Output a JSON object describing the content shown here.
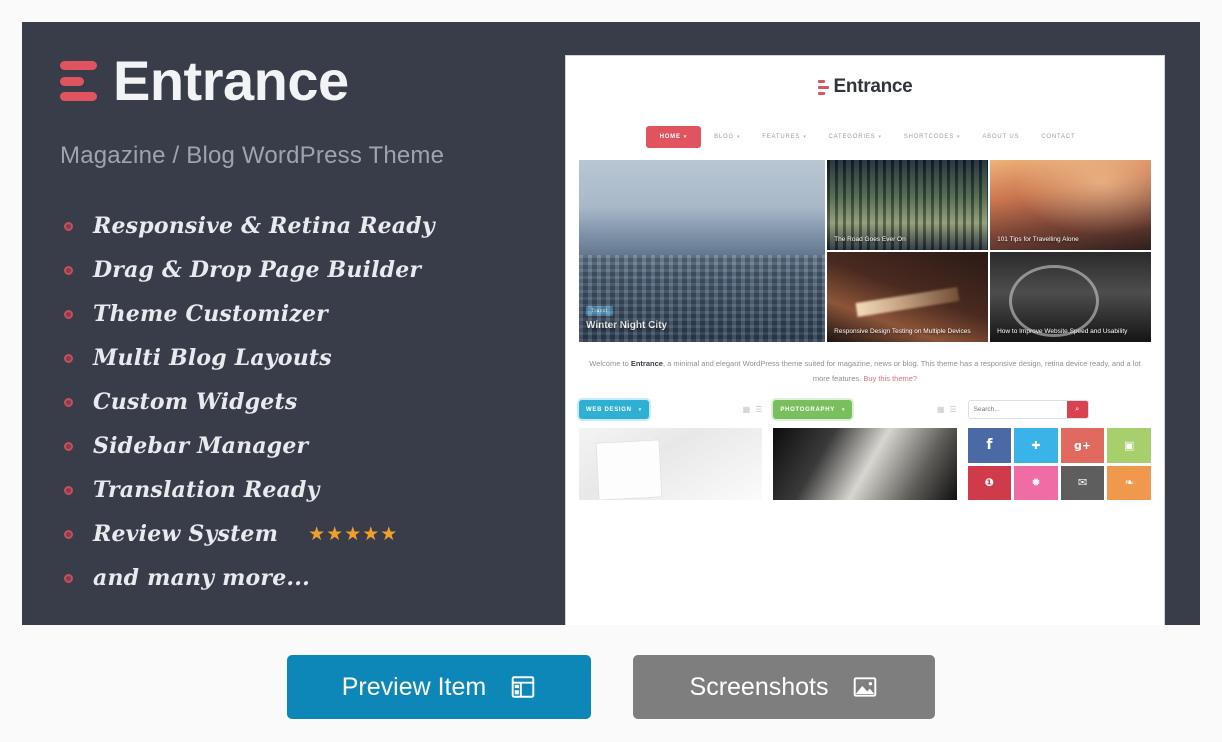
{
  "theme": {
    "accent_red": "#e0545f",
    "panel_bg": "#383d49",
    "page_bg": "#fafafa",
    "preview_button_color": "#0c87b8",
    "screenshots_button_color": "#7e7e7e"
  },
  "hero": {
    "brand_name": "Entrance",
    "tagline": "Magazine / Blog WordPress Theme",
    "features": [
      {
        "label": "Responsive & Retina Ready",
        "stars": ""
      },
      {
        "label": "Drag & Drop Page Builder",
        "stars": ""
      },
      {
        "label": "Theme Customizer",
        "stars": ""
      },
      {
        "label": "Multi Blog Layouts",
        "stars": ""
      },
      {
        "label": "Custom Widgets",
        "stars": ""
      },
      {
        "label": "Sidebar Manager",
        "stars": ""
      },
      {
        "label": "Translation Ready",
        "stars": ""
      },
      {
        "label": "Review System",
        "stars": "★★★★★"
      },
      {
        "label": "and many more...",
        "stars": ""
      }
    ]
  },
  "preview": {
    "brand_name": "Entrance",
    "nav": [
      {
        "label": "HOME",
        "caret": "▾",
        "active": true
      },
      {
        "label": "BLOG",
        "caret": "▾",
        "active": false
      },
      {
        "label": "FEATURES",
        "caret": "▾",
        "active": false
      },
      {
        "label": "CATEGORIES",
        "caret": "▾",
        "active": false
      },
      {
        "label": "SHORTCODES",
        "caret": "▾",
        "active": false
      },
      {
        "label": "ABOUT US",
        "caret": "",
        "active": false
      },
      {
        "label": "CONTACT",
        "caret": "",
        "active": false
      }
    ],
    "grid": {
      "featured": {
        "title": "Winter Night City",
        "category": "Travel"
      },
      "tiles": [
        {
          "title": "The Road Goes Ever On"
        },
        {
          "title": "101 Tips for Travelling Alone"
        },
        {
          "title": "Responsive Design Testing on Multiple Devices"
        },
        {
          "title": "How to Improve Website Speed and Usability"
        }
      ]
    },
    "welcome": {
      "lead": "Welcome to ",
      "brand": "Entrance",
      "body": ", a minimal and elegant WordPress theme suited for magazine, news or blog. This theme has a responsive design, retina device ready, and a lot more features. ",
      "link": "Buy this theme?"
    },
    "widgets": [
      {
        "category": "WEB DESIGN",
        "caret": "▾",
        "color": "#2eafd4"
      },
      {
        "category": "PHOTOGRAPHY",
        "caret": "▾",
        "color": "#79bf5e"
      }
    ],
    "search": {
      "placeholder": "Search...",
      "button_icon": "search-icon"
    },
    "socials": [
      {
        "name": "facebook",
        "glyph": "f",
        "color": "#4a69a5"
      },
      {
        "name": "twitter",
        "glyph": "🐦",
        "color": "#3ab4e8"
      },
      {
        "name": "google-plus",
        "glyph": "g+",
        "color": "#e06a60"
      },
      {
        "name": "vimeo",
        "glyph": "v",
        "color": "#a7d06d"
      },
      {
        "name": "pinterest",
        "glyph": "P",
        "color": "#cf3b4a"
      },
      {
        "name": "dribbble",
        "glyph": "●",
        "color": "#ef6ca5"
      },
      {
        "name": "email",
        "glyph": "✉",
        "color": "#5e5e5e"
      },
      {
        "name": "rss",
        "glyph": "≫",
        "color": "#f0984c"
      }
    ]
  },
  "actions": {
    "preview_label": "Preview Item",
    "preview_icon": "layout-icon",
    "screenshots_label": "Screenshots",
    "screenshots_icon": "image-icon"
  }
}
